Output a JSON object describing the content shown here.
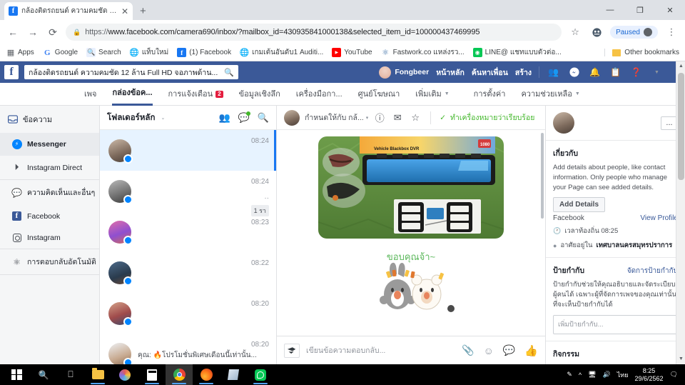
{
  "browser": {
    "tab": {
      "title": "กล้องติดรถยนต์ ความคมชัด 12 ล้าน F",
      "close": "✕"
    },
    "newtab_label": "+",
    "window_controls": {
      "minimize": "—",
      "maximize": "❐",
      "close": "✕"
    },
    "nav": {
      "back": "←",
      "forward": "→",
      "reload": "⟳"
    },
    "omnibox": {
      "lock": "🔒",
      "scheme": "https://",
      "url": "www.facebook.com/camera690/inbox/?mailbox_id=430935841000138&selected_item_id=100000437469995",
      "star": "☆"
    },
    "profile": {
      "status": "Paused"
    },
    "menu": "⋮",
    "bookmarks": [
      {
        "label": "Apps",
        "icon": "apps-grid-icon"
      },
      {
        "label": "Google",
        "icon": "google-icon"
      },
      {
        "label": "Search",
        "icon": "search-icon"
      },
      {
        "label": "แท็บใหม่",
        "icon": "globe-icon"
      },
      {
        "label": "(1) Facebook",
        "icon": "facebook-icon"
      },
      {
        "label": "เกมเต้นอันดับ1 Auditi...",
        "icon": "globe-icon"
      },
      {
        "label": "YouTube",
        "icon": "youtube-icon"
      },
      {
        "label": "Fastwork.co แหล่งรว...",
        "icon": "fastwork-icon"
      },
      {
        "label": "LINE@ แชทแบบตัวต่อ...",
        "icon": "line-icon"
      }
    ],
    "other_bookmarks": "Other bookmarks"
  },
  "facebook": {
    "logo": "f",
    "search": {
      "value": "กล้องติดรถยนต์ ความคมชัด 12 ล้าน Full HD จอภาพด้าน...",
      "icon": "magnifier-icon"
    },
    "topnav": {
      "profile_name": "Fongbeer",
      "links": [
        "หน้าหลัก",
        "ค้นหาเพื่อน",
        "สร้าง"
      ],
      "icons": [
        "friend-requests-icon",
        "messenger-icon",
        "notifications-icon",
        "page-insights-icon",
        "help-icon",
        "account-menu-icon"
      ]
    },
    "page_tabs": [
      {
        "label": "เพจ",
        "active": false,
        "badge": ""
      },
      {
        "label": "กล่องข้อค...",
        "active": true,
        "badge": ""
      },
      {
        "label": "การแจ้งเตือน",
        "active": false,
        "badge": "2"
      },
      {
        "label": "ข้อมูลเชิงลึก",
        "active": false,
        "badge": ""
      },
      {
        "label": "เครื่องมือกา...",
        "active": false,
        "badge": ""
      },
      {
        "label": "ศูนย์โฆษณา",
        "active": false,
        "badge": ""
      },
      {
        "label": "เพิ่มเติม",
        "active": false,
        "badge": "",
        "caret": true
      },
      {
        "label": "การตั้งค่า",
        "active": false,
        "badge": ""
      },
      {
        "label": "ความช่วยเหลือ",
        "active": false,
        "badge": "",
        "caret": true
      }
    ]
  },
  "rail": {
    "title": "ข้อความ",
    "title_icon": "inbox-icon",
    "items": [
      {
        "label": "Messenger",
        "icon": "messenger-icon",
        "active": true
      },
      {
        "label": "Instagram Direct",
        "icon": "instagram-direct-icon",
        "active": false
      },
      {
        "label": "ความคิดเห็นและอื่นๆ",
        "icon": "comment-icon",
        "active": false
      },
      {
        "label": "Facebook",
        "icon": "facebook-icon",
        "active": false
      },
      {
        "label": "Instagram",
        "icon": "instagram-icon",
        "active": false
      },
      {
        "label": "การตอบกลับอัตโนมัติ",
        "icon": "automation-icon",
        "active": false
      }
    ]
  },
  "conversation_list": {
    "folder": "โฟลเดอร์หลัก",
    "folder_caret": "⌄",
    "icons": [
      "people-icon",
      "chat-status-icon",
      "search-icon"
    ],
    "rows": [
      {
        "name": "",
        "snippet": "",
        "time": "08:24",
        "active": true,
        "unread_count": ""
      },
      {
        "name": "",
        "snippet": "",
        "time": "08:24",
        "active": false,
        "dots": "··",
        "unread_count": "1 รา"
      },
      {
        "name": "",
        "snippet": "",
        "time": "08:23",
        "active": false,
        "unread_count": ""
      },
      {
        "name": "",
        "snippet": "",
        "time": "08:22",
        "active": false,
        "unread_count": ""
      },
      {
        "name": "",
        "snippet": "",
        "time": "08:20",
        "active": false,
        "unread_count": ""
      },
      {
        "name": "",
        "snippet": "คุณ: 🔥โปรโมชั่นพิเศษเดือนนี้เท่านั้น...",
        "time": "08:20",
        "active": false,
        "unread_count": ""
      }
    ]
  },
  "thread": {
    "assign_label": "กำหนดให้กับ กล้...",
    "assign_caret": "▾",
    "icons": [
      "alert-icon",
      "mail-icon",
      "star-icon"
    ],
    "done_label": "ทำเครื่องหมายว่าเรียบร้อย",
    "done_icon": "check-icon",
    "image_caption": "Vehicle Blackbox DVR",
    "sticker_text": "ขอบคุณจ้า~",
    "composer": {
      "placeholder": "เขียนข้อความตอบกลับ...",
      "reply_icon": "saved-reply-icon",
      "tools": [
        "attachment-icon",
        "emoji-icon",
        "sticker-icon",
        "like-icon"
      ]
    }
  },
  "right_panel": {
    "menu": "...",
    "about": {
      "title": "เกี่ยวกับ",
      "body": "Add details about people, like contact information. Only people who manage your Page can see added details.",
      "button": "Add Details"
    },
    "facebook_row": {
      "label": "Facebook",
      "link": "View Profile"
    },
    "local_time": {
      "icon": "clock-icon",
      "label": "เวลาท้องถิ่น 08:25"
    },
    "location": {
      "icon": "pin-icon",
      "prefix": "อาศัยอยู่ใน",
      "value": "เทศบาลนครสมุทรปราการ"
    },
    "labels": {
      "title": "ป้ายกำกับ",
      "manage": "จัดการป้ายกำกับ",
      "body": "ป้ายกำกับช่วยให้คุณอธิบายและจัดระเบียบผู้คนได้ เฉพาะผู้ที่จัดการเพจของคุณเท่านั้นที่จะเห็นป้ายกำกับได้",
      "placeholder": "เพิ่มป้ายกำกับ..."
    },
    "activity": {
      "title": "กิจกรรม"
    }
  },
  "taskbar": {
    "items": [
      {
        "name": "start-button",
        "icon": "windows-logo"
      },
      {
        "name": "search-button",
        "icon": "magnifier-icon"
      },
      {
        "name": "task-view-button",
        "icon": "task-view-icon"
      },
      {
        "name": "file-explorer-button",
        "icon": "folder-icon"
      },
      {
        "name": "paint-button",
        "icon": "paint-icon"
      },
      {
        "name": "calculator-button",
        "icon": "calculator-icon"
      },
      {
        "name": "chrome-button",
        "icon": "chrome-icon"
      },
      {
        "name": "firefox-button",
        "icon": "firefox-icon"
      },
      {
        "name": "notes-button",
        "icon": "notes-icon"
      },
      {
        "name": "line-button",
        "icon": "line-icon"
      }
    ],
    "tray": {
      "pen": "🖉",
      "chevron": "︿",
      "network": "🖳",
      "volume": "🕪",
      "language": "ไทย",
      "time": "8:25",
      "date": "29/6/2562",
      "action_center": "🗩"
    }
  },
  "colors": {
    "fb_blue": "#3b5998",
    "accent_blue": "#1877f2",
    "green": "#42b72a",
    "badge_red": "#e41e3f"
  }
}
